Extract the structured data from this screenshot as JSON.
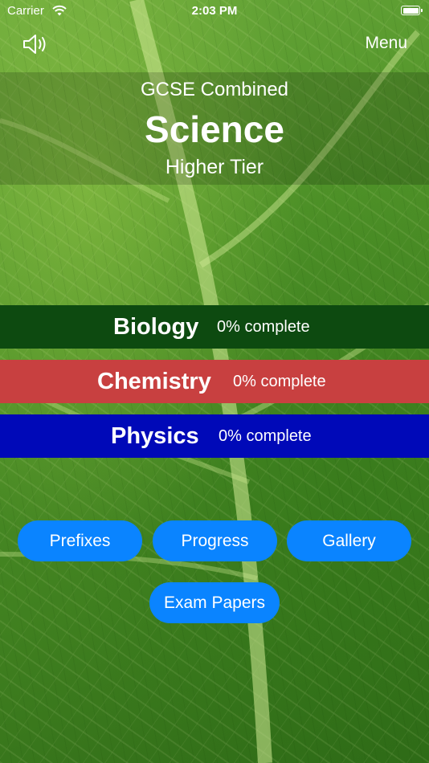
{
  "status_bar": {
    "carrier": "Carrier",
    "time": "2:03 PM"
  },
  "header": {
    "menu_label": "Menu",
    "sound_icon": "speaker-icon"
  },
  "title": {
    "sub": "GCSE Combined",
    "main": "Science",
    "tier": "Higher Tier"
  },
  "subjects": [
    {
      "name": "Biology",
      "progress": "0% complete",
      "color": "#0d4a10"
    },
    {
      "name": "Chemistry",
      "progress": "0% complete",
      "color": "#c84040"
    },
    {
      "name": "Physics",
      "progress": "0% complete",
      "color": "#0009b8"
    }
  ],
  "buttons": {
    "prefixes": "Prefixes",
    "progress": "Progress",
    "gallery": "Gallery",
    "exam_papers": "Exam Papers"
  },
  "colors": {
    "button_blue": "#0a84ff"
  }
}
